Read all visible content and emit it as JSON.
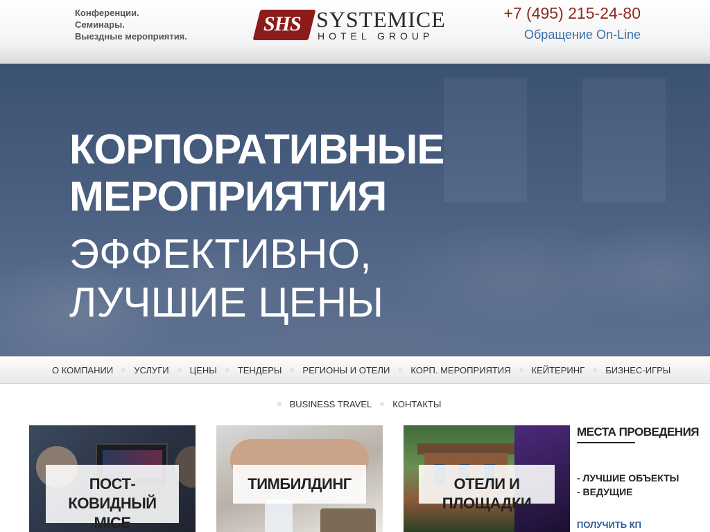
{
  "header": {
    "tagline": [
      "Конференции.",
      "Семинары.",
      "Выездные мероприятия."
    ],
    "logo_mark": "SHS",
    "logo_name": "SYSTEMICE",
    "logo_sub": "HOTEL GROUP",
    "phone": "+7 (495) 215-24-80",
    "online_link": "Обращение On-Line"
  },
  "hero": {
    "title_bold_1": "КОРПОРАТИВНЫЕ",
    "title_bold_2": "МЕРОПРИЯТИЯ",
    "title_light_1": "ЭФФЕКТИВНО,",
    "title_light_2": "ЛУЧШИЕ ЦЕНЫ"
  },
  "nav": {
    "items": [
      "О КОМПАНИИ",
      "УСЛУГИ",
      "ЦЕНЫ",
      "ТЕНДЕРЫ",
      "РЕГИОНЫ И ОТЕЛИ",
      "КОРП. МЕРОПРИЯТИЯ",
      "КЕЙТЕРИНГ",
      "БИЗНЕС-ИГРЫ"
    ],
    "items_row2": [
      "BUSINESS TRAVEL",
      "КОНТАКТЫ"
    ]
  },
  "cards": [
    {
      "label_1": "ПОСТ-КОВИДНЫЙ",
      "label_2": "MICE"
    },
    {
      "label_1": "ТИМБИЛДИНГ"
    },
    {
      "label_1": "ОТЕЛИ И ПЛОЩАДКИ"
    }
  ],
  "side": {
    "title": "МЕСТА ПРОВЕДЕНИЯ",
    "list": [
      "- ЛУЧШИЕ ОБЪЕКТЫ",
      "- ВЕДУЩИЕ"
    ],
    "link": "ПОЛУЧИТЬ КП"
  },
  "colors": {
    "phone": "#8e2a22",
    "link": "#3b6ea8",
    "logo_red": "#8e1b1b",
    "hero_bg": "#4a5f80"
  }
}
